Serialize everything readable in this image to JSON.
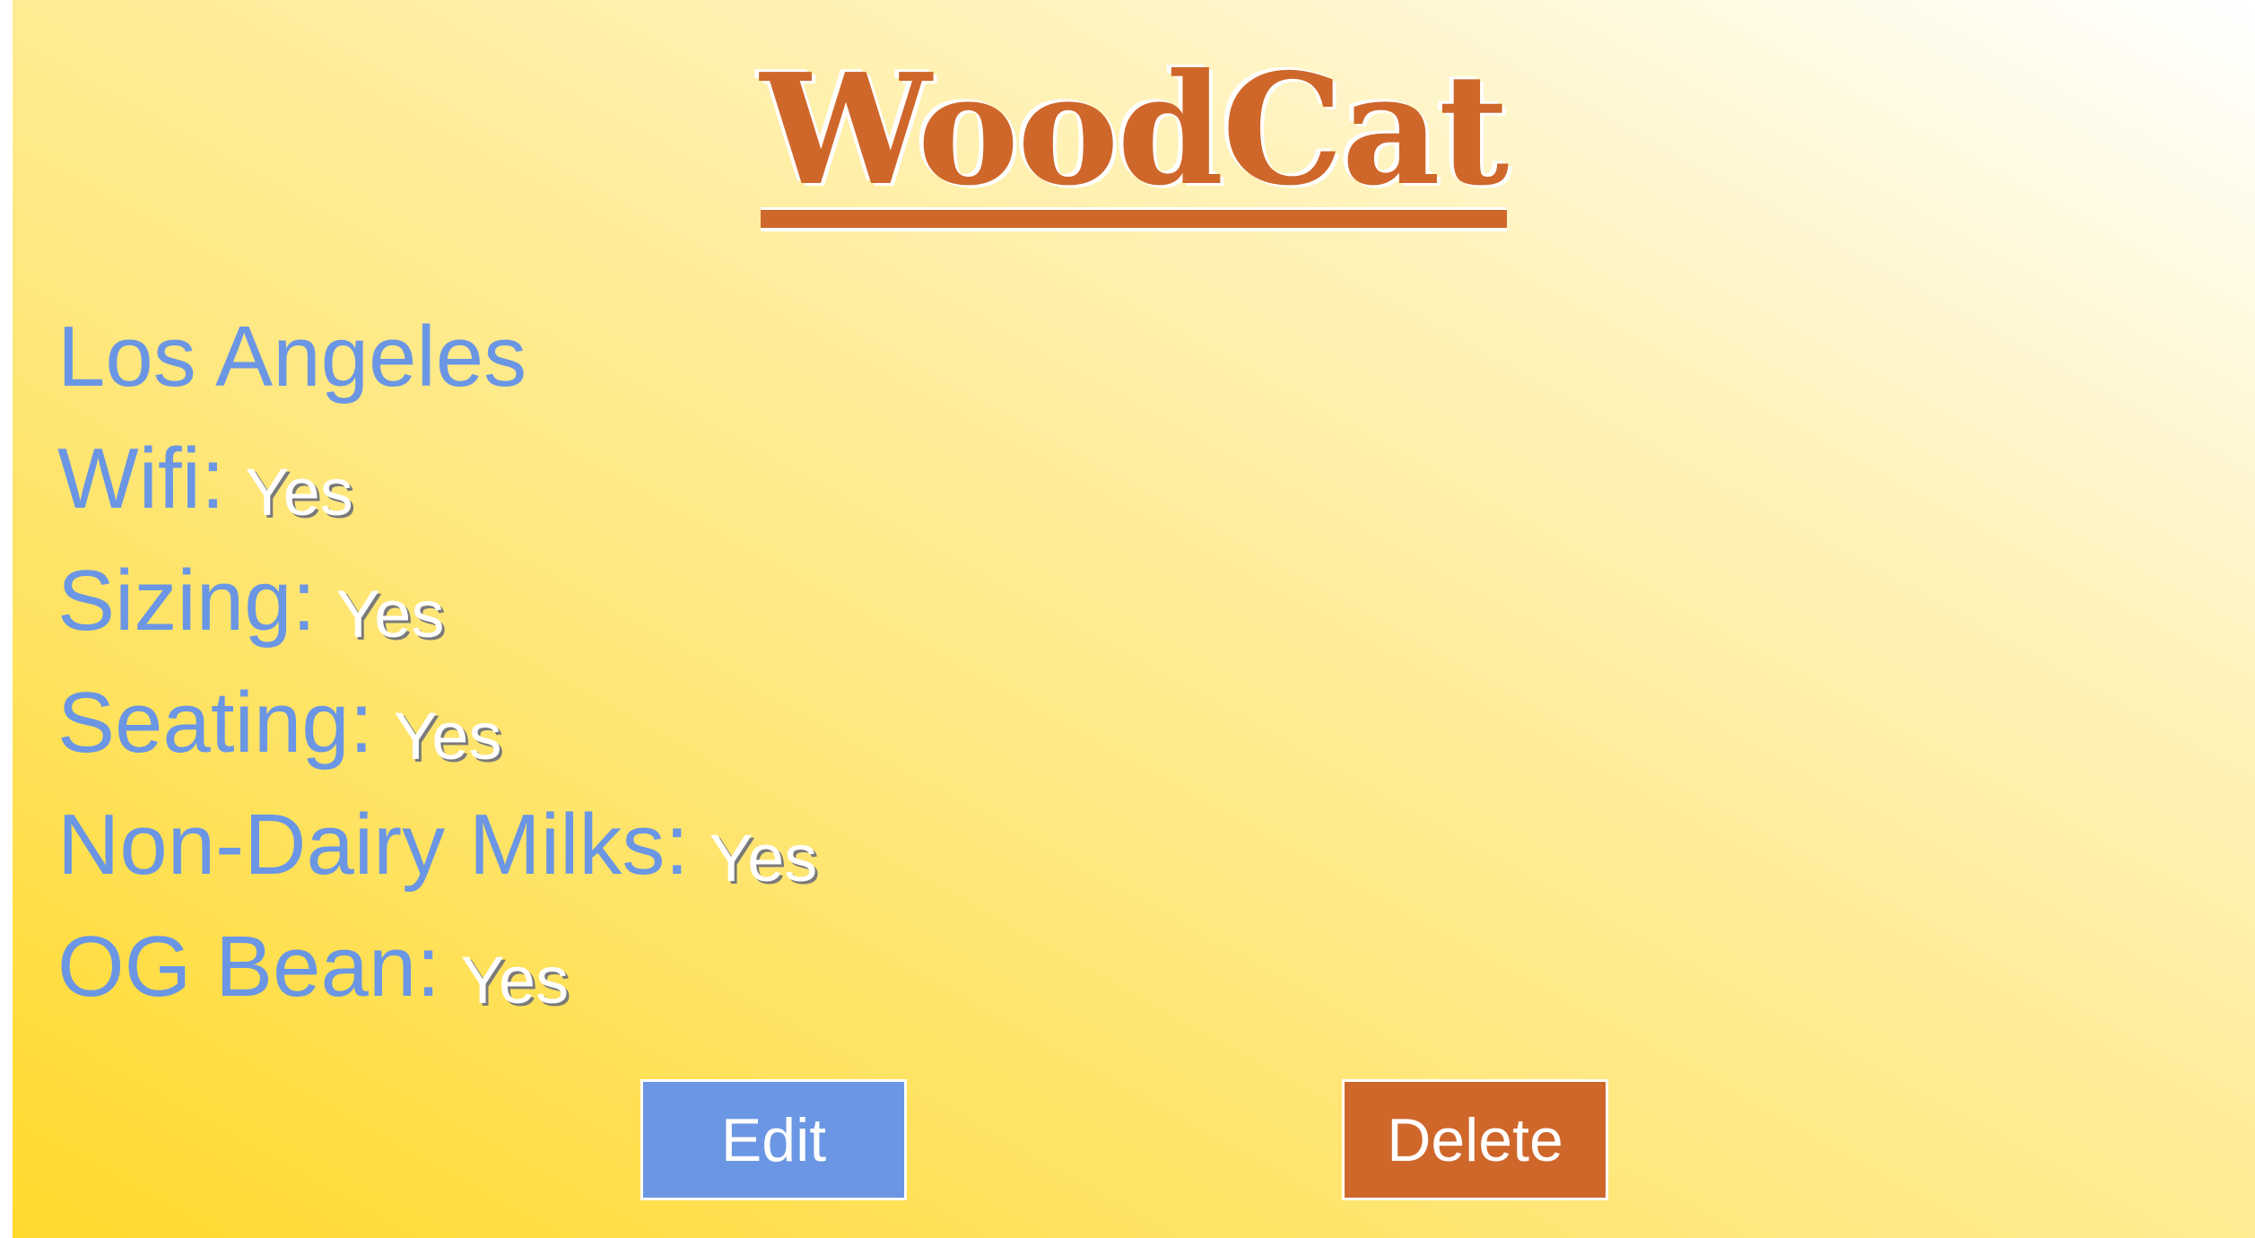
{
  "brand": {
    "title": "WoodCat",
    "color": "#cf672b"
  },
  "shop": {
    "city": "Los Angeles",
    "attributes": [
      {
        "label": "Wifi:",
        "value": "Yes"
      },
      {
        "label": "Sizing:",
        "value": "Yes"
      },
      {
        "label": "Seating:",
        "value": "Yes"
      },
      {
        "label": "Non-Dairy Milks:",
        "value": "Yes"
      },
      {
        "label": "OG Bean:",
        "value": "Yes"
      }
    ]
  },
  "actions": {
    "edit_label": "Edit",
    "delete_label": "Delete"
  },
  "colors": {
    "label_blue": "#6b96e4",
    "accent_orange": "#cf672b",
    "background_yellow": "#ffd92c"
  }
}
